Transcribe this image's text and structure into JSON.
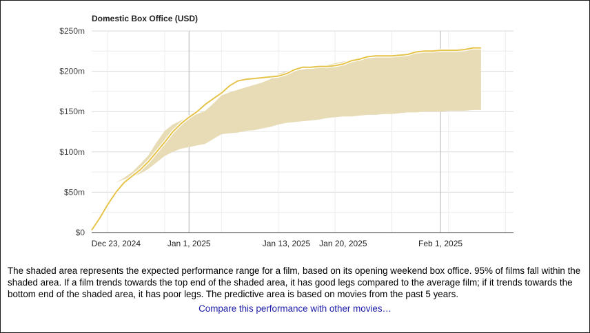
{
  "chart_data": {
    "type": "area",
    "title": "Domestic Box Office (USD)",
    "xlabel": "",
    "ylabel": "",
    "ylim": [
      0,
      250
    ],
    "y_ticks": [
      {
        "value": 0,
        "label": "$0"
      },
      {
        "value": 50,
        "label": "$50m"
      },
      {
        "value": 100,
        "label": "$100m"
      },
      {
        "value": 150,
        "label": "$150m"
      },
      {
        "value": 200,
        "label": "$200m"
      },
      {
        "value": 250,
        "label": "$250m"
      }
    ],
    "x_unit": "day since Dec 20, 2024",
    "xlim": [
      0,
      52
    ],
    "x_ticks": [
      {
        "day": 3,
        "label": "Dec 23, 2024"
      },
      {
        "day": 12,
        "label": "Jan 1, 2025"
      },
      {
        "day": 24,
        "label": "Jan 13, 2025"
      },
      {
        "day": 31,
        "label": "Jan 20, 2025"
      },
      {
        "day": 43,
        "label": "Feb 1, 2025"
      }
    ],
    "grid": true,
    "colors": {
      "line": "#e6c34a",
      "band": "#e8dcb6",
      "grid": "#d9d9d9",
      "major_grid": "#b5b5b5",
      "axis": "#333333"
    },
    "series": [
      {
        "role": "actual",
        "x": [
          0,
          1,
          2,
          3,
          4,
          5,
          6,
          7,
          8,
          9,
          10,
          11,
          12,
          13,
          14,
          15,
          16,
          17,
          18,
          19,
          20,
          21,
          22,
          23,
          24,
          25,
          26,
          27,
          28,
          29,
          30,
          31,
          32,
          33,
          34,
          35,
          36,
          37,
          38,
          39,
          40,
          41,
          42,
          43,
          44,
          45,
          46,
          47,
          48
        ],
        "values": [
          3,
          18,
          35,
          50,
          62,
          70,
          78,
          88,
          100,
          112,
          125,
          135,
          143,
          150,
          159,
          166,
          173,
          182,
          188,
          190,
          191,
          192,
          193,
          194,
          197,
          202,
          205,
          205,
          206,
          206,
          207,
          209,
          213,
          215,
          218,
          219,
          219,
          219,
          220,
          221,
          224,
          225,
          225,
          226,
          226,
          226,
          227,
          229,
          229
        ]
      },
      {
        "role": "expected_range",
        "x": [
          3,
          4,
          5,
          6,
          7,
          8,
          9,
          10,
          11,
          12,
          13,
          14,
          15,
          16,
          17,
          18,
          19,
          20,
          21,
          22,
          23,
          24,
          25,
          26,
          27,
          28,
          29,
          30,
          31,
          32,
          33,
          34,
          35,
          36,
          37,
          38,
          39,
          40,
          41,
          42,
          43,
          44,
          45,
          46,
          47,
          48
        ],
        "upper": [
          62,
          68,
          75,
          85,
          96,
          112,
          126,
          134,
          139,
          143,
          147,
          151,
          160,
          170,
          174,
          177,
          180,
          183,
          186,
          190,
          197,
          200,
          201,
          202,
          204,
          206,
          208,
          210,
          212,
          214,
          216,
          217,
          218,
          219,
          220,
          221,
          223,
          224,
          225,
          225,
          226,
          227,
          228,
          229,
          229,
          229
        ],
        "lower": [
          62,
          66,
          69,
          73,
          79,
          87,
          95,
          100,
          104,
          106,
          108,
          110,
          116,
          122,
          123,
          124,
          126,
          127,
          129,
          131,
          134,
          136,
          137,
          138,
          139,
          140,
          142,
          143,
          144,
          144,
          145,
          146,
          146,
          147,
          147,
          148,
          149,
          149,
          150,
          150,
          150,
          151,
          151,
          151,
          152,
          152
        ]
      }
    ]
  },
  "caption": "The shaded area represents the expected performance range for a film, based on its opening weekend box office. 95% of films fall within the shaded area. If a film trends towards the top end of the shaded area, it has good legs compared to the average film; if it trends towards the bottom end of the shaded area, it has poor legs. The predictive area is based on movies from the past 5 years.",
  "compare_link": "Compare this performance with other movies…"
}
